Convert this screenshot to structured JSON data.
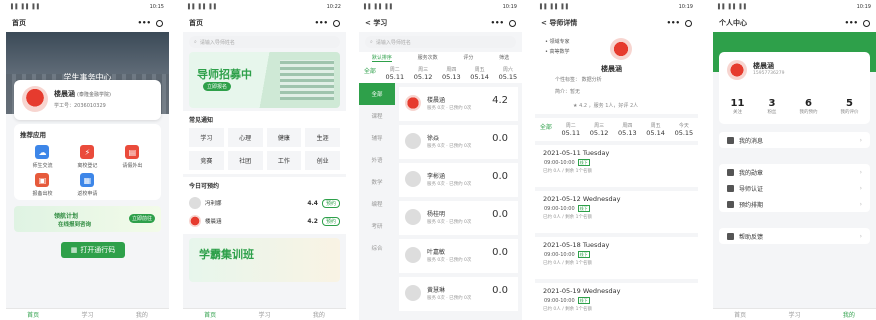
{
  "status": {
    "carrier": "▌▌▐ ▌▐ ▌",
    "time1": "10:15",
    "time2": "10:22",
    "time3": "10:19"
  },
  "p1": {
    "nav_title": "首页",
    "hero_title": "学生事务中心",
    "profile": {
      "name": "楼晨涵",
      "school": "(泰隆金融学院)",
      "id_label": "学工号：2036010329"
    },
    "apps_title": "推荐应用",
    "apps": [
      {
        "label": "师生交流",
        "icon": "chat-icon",
        "color": "#3d86e8"
      },
      {
        "label": "离校登记",
        "icon": "bolt-icon",
        "color": "#ea4b3b"
      },
      {
        "label": "请假外出",
        "icon": "doc-icon",
        "color": "#ea4b3b"
      },
      {
        "label": "报备出校",
        "icon": "doc-icon",
        "color": "#e65a3b"
      },
      {
        "label": "返校申请",
        "icon": "calendar-icon",
        "color": "#3d86e8"
      }
    ],
    "banner": {
      "line1": "领航计划",
      "line2": "在线报到咨询",
      "join": "立即前往"
    },
    "scan_label": "打开通行码"
  },
  "p2": {
    "nav_title": "首页",
    "search_placeholder": "请输入导师姓名",
    "recruit_title": "导师招募中",
    "recruit_button": "立即报名",
    "help_title": "常见通知",
    "categories": [
      "学习",
      "心理",
      "健康",
      "生涯",
      "竞赛",
      "社团",
      "工作",
      "创业"
    ],
    "today_title": "今日可预约",
    "tutors": [
      {
        "name": "冯利娜",
        "score": "4.4",
        "book": "预约",
        "red": false
      },
      {
        "name": "楼晨涵",
        "score": "4.2",
        "book": "预约",
        "red": true
      }
    ],
    "study_title": "学霸集训班"
  },
  "p3": {
    "nav_title": "学习",
    "back": "<",
    "search_placeholder": "请输入导师姓名",
    "tabs": [
      "默认排序",
      "服务次数",
      "评分",
      "筛选"
    ],
    "dates": [
      {
        "w": "全部",
        "d": ""
      },
      {
        "w": "周二",
        "d": "05.11"
      },
      {
        "w": "周三",
        "d": "05.12"
      },
      {
        "w": "周四",
        "d": "05.13"
      },
      {
        "w": "周五",
        "d": "05.14"
      },
      {
        "w": "周六",
        "d": "05.15"
      }
    ],
    "side": [
      "全部",
      "课程",
      "辅导",
      "外语",
      "数学",
      "编程",
      "考研",
      "综合"
    ],
    "tutors": [
      {
        "name": "楼晨涵",
        "score": "4.2",
        "sub": "服务 0次 · 已预约 0次",
        "red": true
      },
      {
        "name": "徐焱",
        "score": "0.0",
        "sub": "服务 0次 · 已预约 0次",
        "red": false
      },
      {
        "name": "李彬涵",
        "score": "0.0",
        "sub": "服务 0次 · 已预约 0次",
        "red": false
      },
      {
        "name": "杨桂明",
        "score": "0.0",
        "sub": "服务 0次 · 已预约 0次",
        "red": false
      },
      {
        "name": "叶嘉敏",
        "score": "0.0",
        "sub": "服务 0次 · 已预约 0次",
        "red": false
      },
      {
        "name": "黄慧琳",
        "score": "0.0",
        "sub": "服务 0次 · 已预约 0次",
        "red": false
      }
    ]
  },
  "p4": {
    "nav_title": "导师详情",
    "back": "<",
    "tags": [
      "• 领域专家",
      "• 高等数学"
    ],
    "name": "楼晨涵",
    "meta1": "个性标签：  数据分析",
    "meta2": "简介：暂无",
    "rating": "★ 4.2 ，服务 1人，好评 2人",
    "dates": [
      {
        "w": "全部",
        "d": ""
      },
      {
        "w": "周二",
        "d": "05.11"
      },
      {
        "w": "周三",
        "d": "05.12"
      },
      {
        "w": "周四",
        "d": "05.13"
      },
      {
        "w": "周五",
        "d": "05.14"
      },
      {
        "w": "今天",
        "d": "05.15"
      }
    ],
    "days": [
      {
        "date": "2021-05-11  Tuesday",
        "slot": "09:00-10:00",
        "tag": "线下",
        "info": "已约 0人 / 剩余 1个名额"
      },
      {
        "date": "2021-05-12  Wednesday",
        "slot": "09:00-10:00",
        "tag": "线下",
        "info": "已约 0人 / 剩余 1个名额"
      },
      {
        "date": "2021-05-18  Tuesday",
        "slot": "09:00-10:00",
        "tag": "线下",
        "info": "已约 0人 / 剩余 1个名额"
      },
      {
        "date": "2021-05-19  Wednesday",
        "slot": "09:00-10:00",
        "tag": "线下",
        "info": "已约 0人 / 剩余 1个名额"
      }
    ]
  },
  "p5": {
    "nav_title": "个人中心",
    "name": "楼晨涵",
    "phone": "15957736279",
    "stats": [
      {
        "n": "11",
        "l": "关注"
      },
      {
        "n": "3",
        "l": "粉丝"
      },
      {
        "n": "6",
        "l": "我的预约"
      },
      {
        "n": "5",
        "l": "我的评价"
      }
    ],
    "menu1": [
      "我的消息"
    ],
    "menu2": [
      "我的勋章",
      "导师认证",
      "预约排期"
    ],
    "menu3": [
      "帮助反馈"
    ]
  },
  "tabbar": [
    "首页",
    "学习",
    "我的"
  ]
}
